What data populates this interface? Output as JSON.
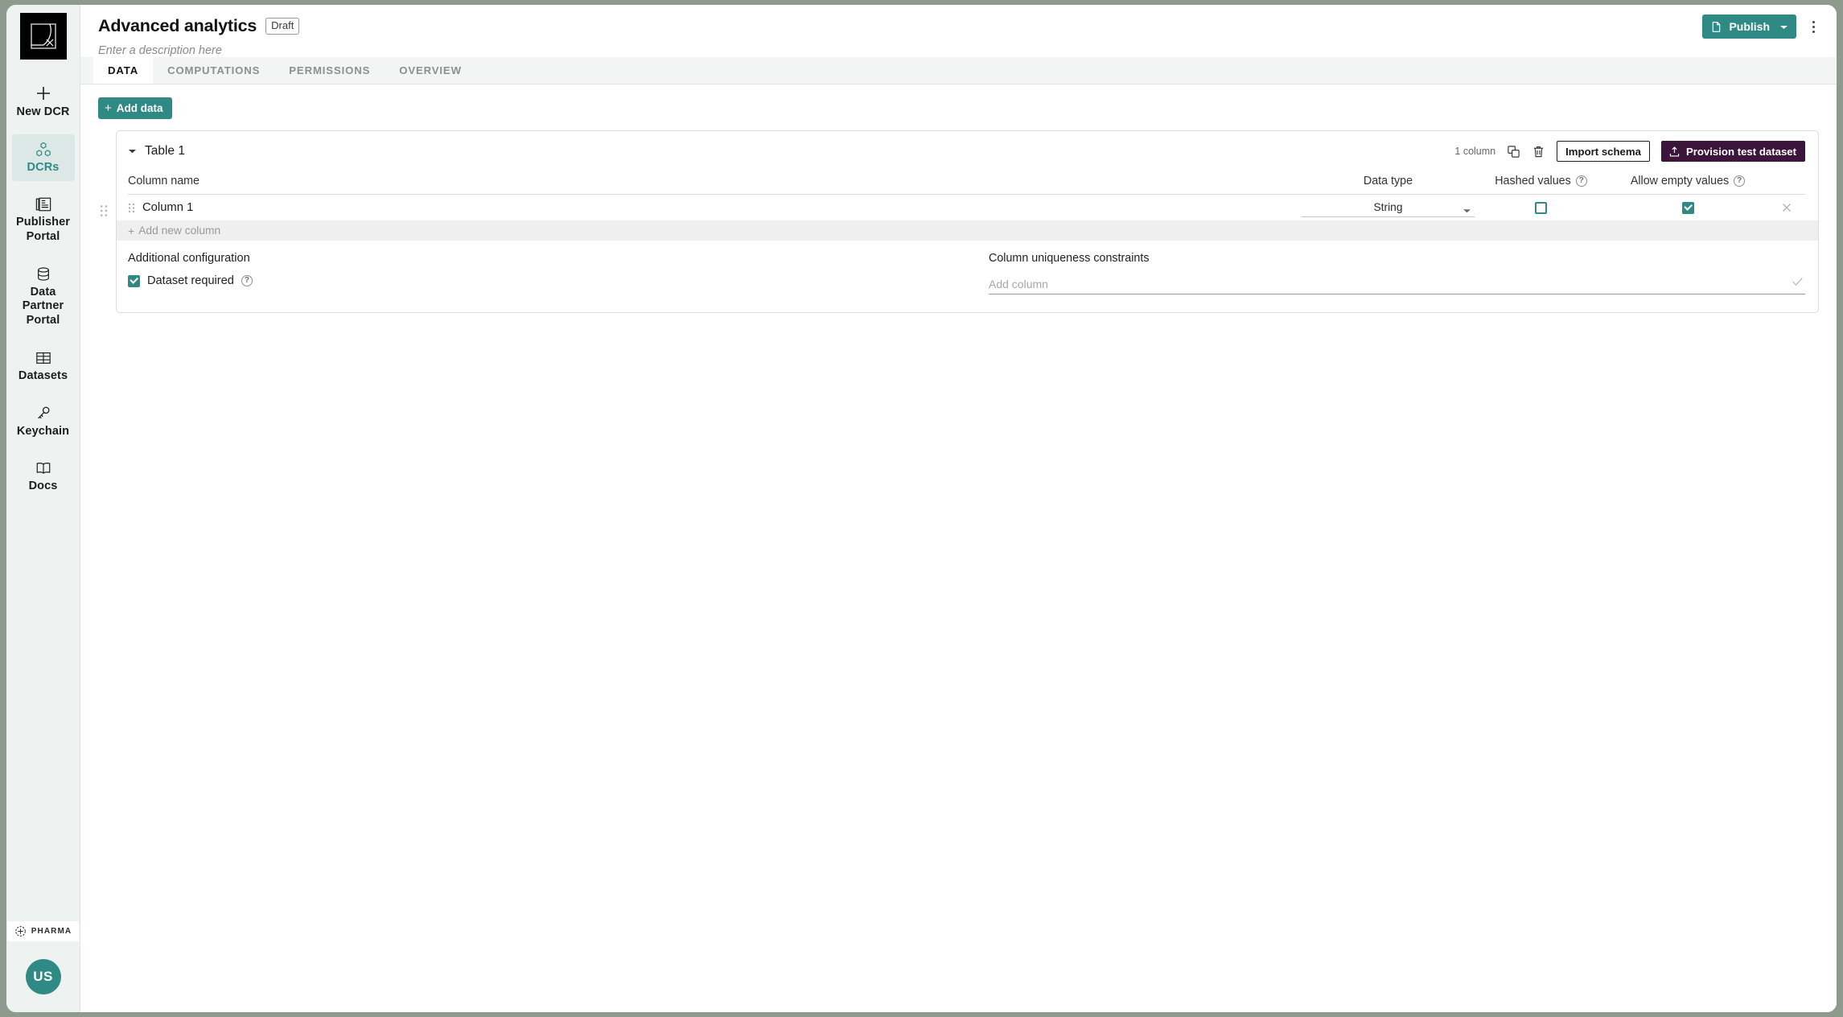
{
  "brand": {
    "accent": "#2f8a86",
    "dark_accent": "#3b153b",
    "logo_name": "decentriq-logo"
  },
  "sidebar": {
    "items": [
      {
        "label": "New DCR",
        "icon": "plus-icon",
        "active": false
      },
      {
        "label": "DCRs",
        "icon": "cubes-icon",
        "active": true
      },
      {
        "label": "Publisher Portal",
        "icon": "newspaper-icon",
        "active": false
      },
      {
        "label": "Data Partner Portal",
        "icon": "database-icon",
        "active": false
      },
      {
        "label": "Datasets",
        "icon": "table-grid-icon",
        "active": false
      },
      {
        "label": "Keychain",
        "icon": "key-icon",
        "active": false
      },
      {
        "label": "Docs",
        "icon": "book-icon",
        "active": false
      }
    ],
    "org_badge": "PHARMA",
    "avatar_initials": "US"
  },
  "header": {
    "title": "Advanced analytics",
    "status_badge": "Draft",
    "description_placeholder": "Enter a description here",
    "publish_label": "Publish",
    "publish_icon": "document-icon",
    "publish_caret_icon": "chevron-down-icon",
    "more_icon": "kebab-menu-icon"
  },
  "tabs": [
    {
      "label": "DATA",
      "active": true
    },
    {
      "label": "COMPUTATIONS",
      "active": false
    },
    {
      "label": "PERMISSIONS",
      "active": false
    },
    {
      "label": "OVERVIEW",
      "active": false
    }
  ],
  "toolbar": {
    "add_data_label": "Add data",
    "add_data_icon": "plus-icon"
  },
  "table_card": {
    "collapse_icon": "caret-down-icon",
    "name": "Table 1",
    "column_count_label": "1 column",
    "duplicate_icon": "copy-icon",
    "delete_icon": "trash-icon",
    "import_schema_label": "Import schema",
    "provision_label": "Provision test dataset",
    "provision_icon": "upload-icon",
    "columns_header": {
      "name": "Column name",
      "data_type": "Data type",
      "hashed_values": "Hashed values",
      "allow_empty_values": "Allow empty values"
    },
    "rows": [
      {
        "drag_icon": "drag-handle-icon",
        "name": "Column 1",
        "data_type": "String",
        "data_type_caret": "caret-down-icon",
        "hashed": false,
        "allow_empty": true,
        "delete_icon": "close-x-icon"
      }
    ],
    "add_new_column_label": "Add new column",
    "add_new_column_icon": "plus-icon",
    "additional_configuration": {
      "title": "Additional configuration",
      "dataset_required_label": "Dataset required",
      "dataset_required_checked": true,
      "help_icon": "help-circle-icon"
    },
    "uniqueness": {
      "title": "Column uniqueness constraints",
      "input_placeholder": "Add column",
      "input_value": "",
      "confirm_icon": "check-icon"
    }
  }
}
